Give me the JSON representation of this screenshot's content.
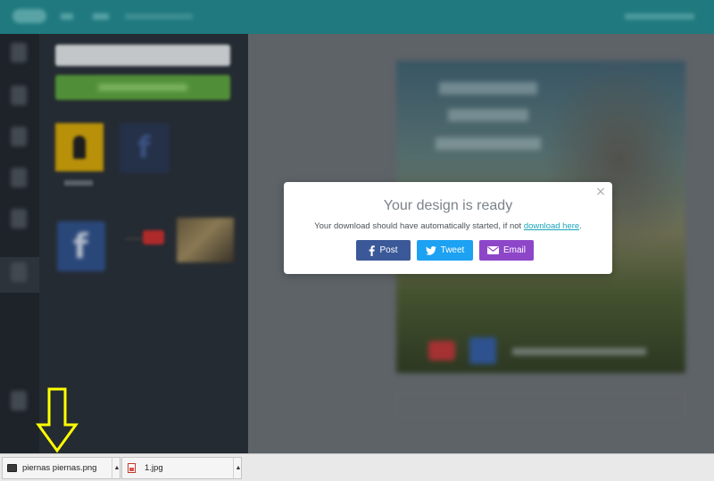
{
  "modal": {
    "title": "Your design is ready",
    "message_prefix": "Your download should have automatically started, if not ",
    "link_text": "download here",
    "message_suffix": ".",
    "close_glyph": "×",
    "buttons": [
      {
        "label": "Post",
        "icon": "facebook-icon",
        "color": "#3b5998"
      },
      {
        "label": "Tweet",
        "icon": "twitter-icon",
        "color": "#1da1f2"
      },
      {
        "label": "Email",
        "icon": "envelope-icon",
        "color": "#8e46c9"
      }
    ]
  },
  "downloads": [
    {
      "filename": "piernas piernas.png",
      "icon": "image-file-icon"
    },
    {
      "filename": "1.jpg",
      "icon": "jpg-file-icon"
    }
  ],
  "annotation": {
    "arrow_color": "#ffff00",
    "points_to": "download-item-piernas"
  },
  "colors": {
    "topbar": "#1e8a90",
    "upload_button": "#5aa53a",
    "link": "#1aa5ba"
  }
}
